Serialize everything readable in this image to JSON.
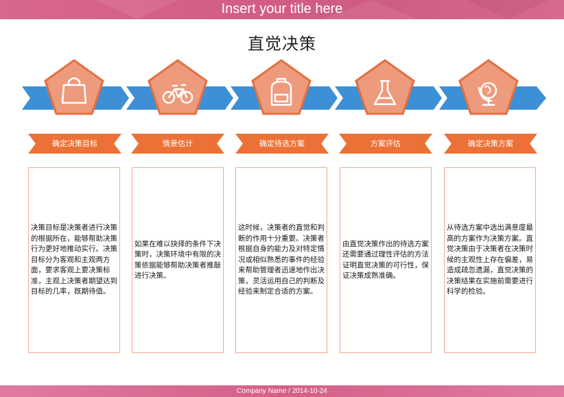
{
  "header": {
    "title": "Insert your title here"
  },
  "main_title": "直觉决策",
  "colors": {
    "arrow_blue": "#3d8fd6",
    "pentagon_fill": "#ee9a7c",
    "pentagon_stroke": "#e2703f",
    "ribbon_orange": "#ec7136",
    "card_border": "#f0a890"
  },
  "steps": [
    {
      "label": "确定决策目标",
      "icon": "shopping-bag-icon",
      "text": "决策目标是决策者进行决策的根据所在，能够帮助决策行为更好地推动实行。决策目标分为客观和主观两方面，要求客观上要决策标准，主观上决策者期望达到目标的几率，既期待值。"
    },
    {
      "label": "情景估计",
      "icon": "bicycle-icon",
      "text": "如果在难以抉择的条件下决策时，决策环境中有限的决策依据能够帮助决策者推敲进行决策。"
    },
    {
      "label": "确定待选方案",
      "icon": "backpack-icon",
      "text": "这时候，决策者的直觉和判断的作用十分重要。决策者根据自身的能力及对特定情况或相似熟悉的事件的经验来帮助管理者迅速地作出决策，灵活运用自己的判断及经验来制定合适的方案。"
    },
    {
      "label": "方案评估",
      "icon": "flask-icon",
      "text": "由直觉决策作出的待选方案还需要通过理性评估的方法证明直觉决策的可行性，保证决策成熟准确。"
    },
    {
      "label": "确定决策方案",
      "icon": "globe-icon",
      "text": "从待选方案中选出满意度最高的方案作为决策方案。直觉决策由于决策者在决策时候的主观性上存在偏差，易造成疏忽遗漏，直觉决策的决策结果在实施前需要进行科学的检验。"
    }
  ],
  "footer": {
    "text": "Company Name / 2014-10-24"
  }
}
